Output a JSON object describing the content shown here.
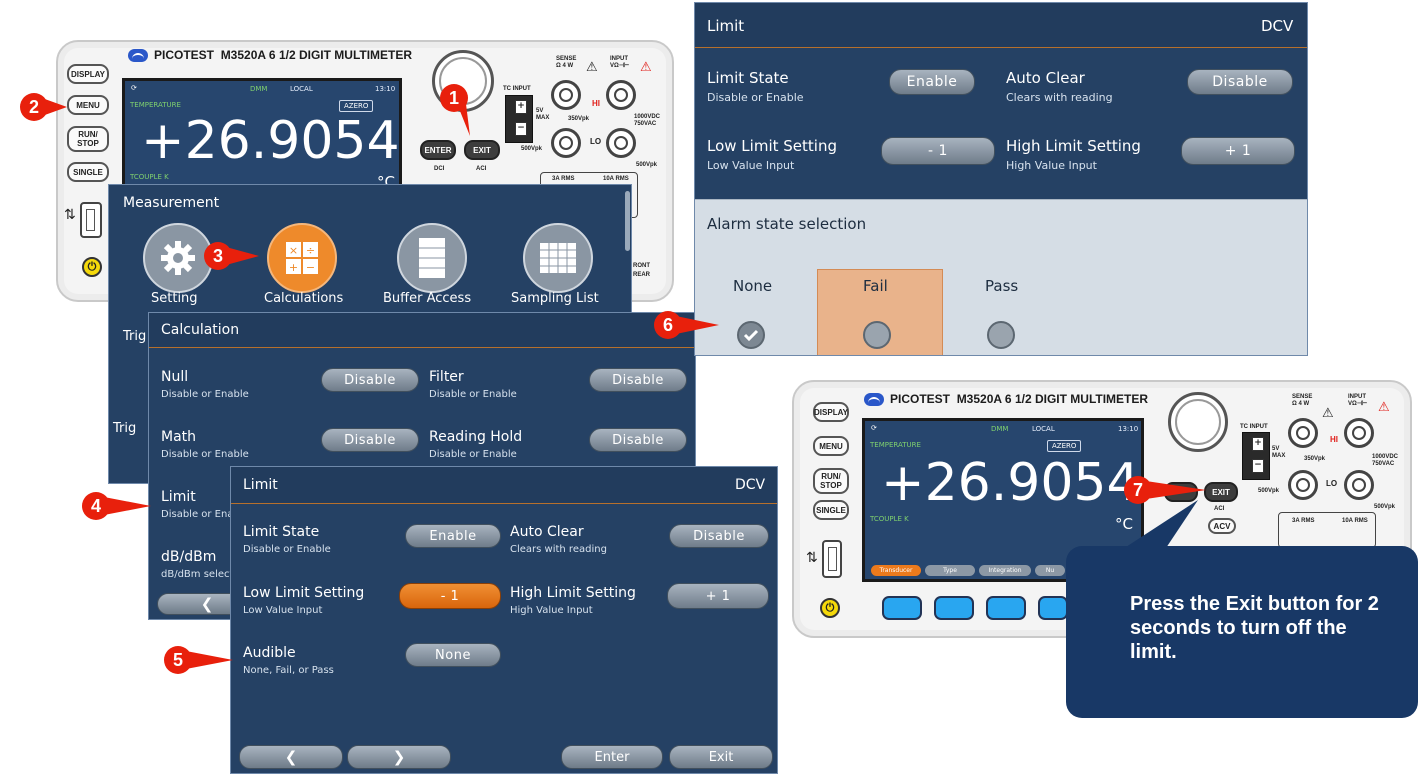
{
  "meter": {
    "brand": "PICOTEST",
    "model": "M3520A 6 1/2 DIGIT MULTIMETER",
    "buttons": {
      "display": "DISPLAY",
      "menu": "MENU",
      "run_stop": "RUN/\nSTOP",
      "single": "SINGLE",
      "enter": "ENTER",
      "exit": "EXIT",
      "dci": "DCI",
      "aci": "ACI",
      "acv": "ACV"
    },
    "screen": {
      "label": "TEMPERATURE",
      "mode": "DMM",
      "local": "LOCAL",
      "time": "13:10",
      "azero": "AZERO",
      "reading": "+26.9054",
      "unit": "°C",
      "sensor": "TCOUPLE K"
    },
    "jacks": {
      "tc_input": "TC INPUT",
      "sense": "SENSE\nΩ 4 W",
      "input": "INPUT\nVΩ⊣⊢",
      "hi": "HI",
      "lo": "LO",
      "v5_max": "5V\nMAX",
      "v350pk": "350Vpk",
      "v1000": "1000VDC\n750VAC",
      "v500pk_l": "500Vpk",
      "v500pk_r": "500Vpk",
      "a3": "3A RMS",
      "a10": "10A RMS",
      "front": "RONT",
      "rear": "REAR"
    },
    "softkey_tabs": [
      "Transducer",
      "Type",
      "Integration",
      "Nu"
    ]
  },
  "measurement_menu": {
    "title": "Measurement",
    "items": [
      "Setting",
      "Calculations",
      "Buffer Access",
      "Sampling List"
    ],
    "side_labels": [
      "Trig",
      "Trig"
    ]
  },
  "calculation": {
    "title": "Calculation",
    "rows": [
      {
        "label": "Null",
        "sub": "Disable or Enable",
        "value": "Disable"
      },
      {
        "label": "Filter",
        "sub": "Disable or Enable",
        "value": "Disable"
      },
      {
        "label": "Math",
        "sub": "Disable or Enable",
        "value": "Disable"
      },
      {
        "label": "Reading Hold",
        "sub": "Disable or Enable",
        "value": "Disable"
      },
      {
        "label": "Limit",
        "sub": "Disable or Ena"
      },
      {
        "label": "dB/dBm",
        "sub": "dB/dBm select"
      }
    ]
  },
  "limit_main": {
    "title": "Limit",
    "mode": "DCV",
    "limit_state": {
      "label": "Limit State",
      "sub": "Disable or Enable",
      "value": "Enable"
    },
    "auto_clear": {
      "label": "Auto Clear",
      "sub": "Clears with reading",
      "value": "Disable"
    },
    "low_limit": {
      "label": "Low Limit Setting",
      "sub": "Low Value Input",
      "value": "- 1"
    },
    "high_limit": {
      "label": "High Limit Setting",
      "sub": "High Value Input",
      "value": "+ 1"
    },
    "audible": {
      "label": "Audible",
      "sub": "None, Fail, or Pass",
      "value": "None"
    },
    "nav": {
      "prev": "❮",
      "next": "❯",
      "enter": "Enter",
      "exit": "Exit"
    }
  },
  "limit_alarm": {
    "title": "Limit",
    "mode": "DCV",
    "limit_state": {
      "label": "Limit State",
      "sub": "Disable or Enable",
      "value": "Enable"
    },
    "auto_clear": {
      "label": "Auto Clear",
      "sub": "Clears with reading",
      "value": "Disable"
    },
    "low_limit": {
      "label": "Low Limit Setting",
      "sub": "Low Value Input",
      "value": "- 1"
    },
    "high_limit": {
      "label": "High Limit Setting",
      "sub": "High Value Input",
      "value": "+ 1"
    },
    "alarm": {
      "title": "Alarm state selection",
      "options": [
        "None",
        "Fail",
        "Pass"
      ],
      "selected": "None",
      "highlighted": "Fail"
    }
  },
  "steps": [
    "1",
    "2",
    "3",
    "4",
    "5",
    "6",
    "7"
  ],
  "callout": {
    "text": "Press the Exit button for 2 seconds to turn off the limit."
  },
  "colors": {
    "step_badge": "#e8200c",
    "accent_orange": "#ec7a1c",
    "panel_blue": "#254164",
    "callout_blue": "#183866"
  }
}
